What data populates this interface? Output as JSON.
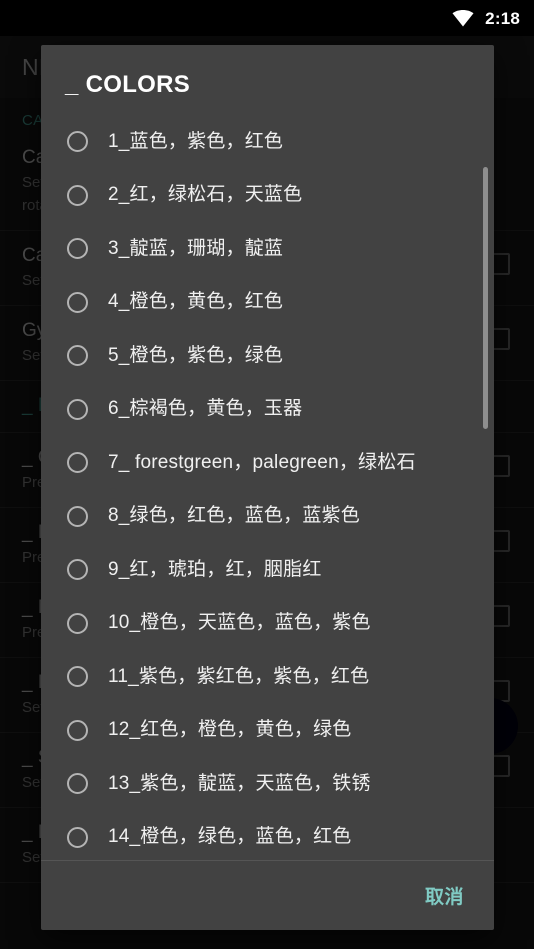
{
  "status_bar": {
    "time": "2:18",
    "wifi_icon": "wifi-icon"
  },
  "background": {
    "app_bar_title": "NE",
    "section_header": "CA",
    "rows": [
      {
        "title": "Ca",
        "sub": "Set",
        "sub2": "rota",
        "checkbox": false,
        "accent": false
      },
      {
        "title": "Ca",
        "sub": "Set",
        "sub2": "",
        "checkbox": true,
        "accent": false
      },
      {
        "title": "Gy",
        "sub": "Set",
        "sub2": "",
        "checkbox": true,
        "accent": false
      },
      {
        "title": "_ N",
        "sub": "",
        "sub2": "",
        "checkbox": false,
        "accent": true
      },
      {
        "title": "_ O",
        "sub": "Pre",
        "sub2": "",
        "checkbox": true,
        "accent": false
      },
      {
        "title": "_ B",
        "sub": "Pre",
        "sub2": "",
        "checkbox": true,
        "accent": false
      },
      {
        "title": "_ M",
        "sub": "Pre",
        "sub2": "",
        "checkbox": true,
        "accent": false
      },
      {
        "title": "_ B",
        "sub": "Set",
        "sub2": "",
        "checkbox": true,
        "accent": false
      },
      {
        "title": "_ S",
        "sub": "Set",
        "sub2": "",
        "checkbox": true,
        "accent": false
      },
      {
        "title": "_ R",
        "sub": "Set",
        "sub2": "",
        "checkbox": false,
        "accent": false
      }
    ],
    "fab": "floating-action-button"
  },
  "dialog": {
    "title": "_ COLORS",
    "options": [
      {
        "label": "1_蓝色，紫色，红色",
        "selected": false
      },
      {
        "label": "2_红，绿松石，天蓝色",
        "selected": false
      },
      {
        "label": "3_靛蓝，珊瑚，靛蓝",
        "selected": false
      },
      {
        "label": "4_橙色，黄色，红色",
        "selected": false
      },
      {
        "label": "5_橙色，紫色，绿色",
        "selected": false
      },
      {
        "label": "6_棕褐色，黄色，玉器",
        "selected": false
      },
      {
        "label": "7_ forestgreen，palegreen，绿松石",
        "selected": false
      },
      {
        "label": "8_绿色，红色，蓝色，蓝紫色",
        "selected": false
      },
      {
        "label": "9_红，琥珀，红，胭脂红",
        "selected": false
      },
      {
        "label": "10_橙色，天蓝色，蓝色，紫色",
        "selected": false
      },
      {
        "label": "11_紫色，紫红色，紫色，红色",
        "selected": false
      },
      {
        "label": "12_红色，橙色，黄色，绿色",
        "selected": false
      },
      {
        "label": "13_紫色，靛蓝，天蓝色，铁锈",
        "selected": false
      },
      {
        "label": "14_橙色，绿色，蓝色，红色",
        "selected": false
      }
    ],
    "cancel_label": "取消",
    "scrollbar_visible": true
  },
  "colors": {
    "dialog_bg": "#424242",
    "screen_bg": "#0d0d0d",
    "status_bar_bg": "#000000",
    "accent_teal": "#80cbc4",
    "section_accent": "#2e6a63",
    "option_text": "#f0f0f0",
    "radio_ring": "#b4b4b4",
    "scrollbar_thumb": "#8e8e8e"
  }
}
